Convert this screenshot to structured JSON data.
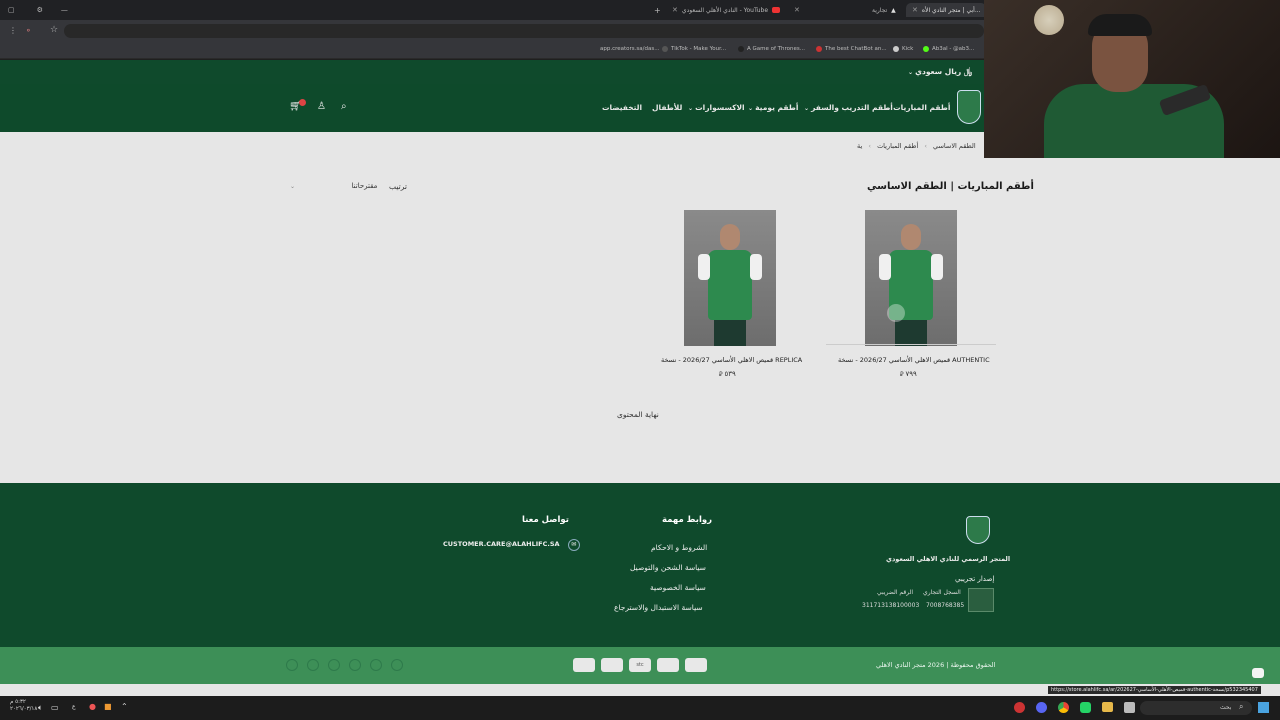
{
  "browser": {
    "tabs": [
      {
        "label": "أبي | متجر النادي الأه..."
      },
      {
        "label": "تجارية"
      },
      {
        "label": "النادي الأهلي السعودي - YouTube"
      }
    ],
    "bookmarks": [
      {
        "label": "app.creators.sa/das..."
      },
      {
        "label": "TikTok - Make Your..."
      },
      {
        "label": "A Game of Thrones..."
      },
      {
        "label": "The best ChatBot an..."
      },
      {
        "label": "Kick"
      },
      {
        "label": "Ab3al - @ab3..."
      }
    ]
  },
  "site": {
    "currency": "﷼ ريال سعودي",
    "nav": [
      {
        "label": "أطقم المباريات"
      },
      {
        "label": "أطقم التدريب والسفر"
      },
      {
        "label": "أطقم يومية"
      },
      {
        "label": "الاكسسوارات"
      },
      {
        "label": "للأطفال"
      },
      {
        "label": "التخفيضات"
      }
    ],
    "breadcrumb": {
      "home": "ية",
      "sep": "›",
      "level1": "أطقم المباريات",
      "current": "الطقم الاساسي"
    },
    "page_title": "أطقم المباريات | الطقم الاساسي",
    "sort": {
      "label": "ترتيب",
      "value": "مقترحاتنا"
    },
    "products": [
      {
        "name": "قميص الاهلي الأساسي 2026/27 - نسخة AUTHENTIC",
        "price": "٧٩٩"
      },
      {
        "name": "قميص الاهلي الأساسي 2026/27 - نسخة REPLICA",
        "price": "٥٣٩"
      }
    ],
    "end_of_content": "نهاية المحتوى"
  },
  "footer": {
    "store_title": "المتجر الرسمي للنادي الاهلي السعودي",
    "version": "إصدار تجريبي",
    "cr_label": "السجل التجاري",
    "cr_value": "7008768385",
    "tax_label": "الرقم الضريبي",
    "tax_value": "311713138100003",
    "links_title": "روابط مهمة",
    "links": [
      {
        "label": "الشروط و الاحكام"
      },
      {
        "label": "سياسة الشحن والتوصيل"
      },
      {
        "label": "سياسة الخصوصية"
      },
      {
        "label": "سياسة الاستبدال والاسترجاع"
      }
    ],
    "contact_title": "تواصل معنا",
    "email": "CUSTOMER.CARE@ALAHLIFC.SA",
    "copyright": "الحقوق محفوظة | 2026 متجر النادي الاهلي",
    "payments": [
      "",
      "",
      "stc",
      "",
      ""
    ]
  },
  "status_url": "https://store.alahlifc.sa/ar/قميص-الأهلي-الأساسي-202627-authentic-نسخة/p532345407",
  "taskbar": {
    "time": "٥:٣٢ م",
    "date": "٢٠٢٦/٠٣/١٨",
    "search": "بحث"
  },
  "colors": {
    "brand_dark": "#0f4a2c",
    "brand_green": "#3d8f57",
    "page_bg": "#e6e6e6"
  }
}
